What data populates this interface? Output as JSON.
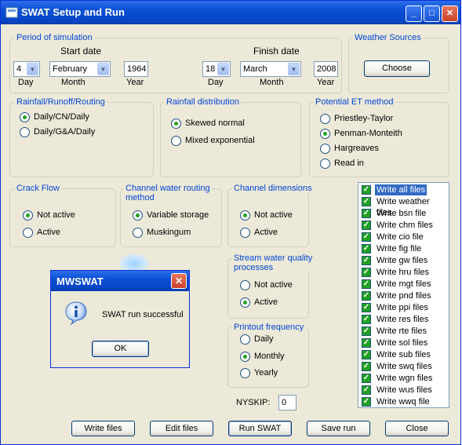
{
  "window": {
    "title": "SWAT Setup and Run",
    "min": "_",
    "max": "□",
    "close": "✕"
  },
  "period": {
    "title": "Period of simulation",
    "start_label": "Start date",
    "finish_label": "Finish date",
    "start": {
      "day": "4",
      "month": "February",
      "year": "1964"
    },
    "finish": {
      "day": "18",
      "month": "March",
      "year": "2008"
    },
    "day_label": "Day",
    "month_label": "Month",
    "year_label": "Year"
  },
  "weather": {
    "title": "Weather Sources",
    "button": "Choose"
  },
  "routing": {
    "title": "Rainfall/Runoff/Routing",
    "options": [
      "Daily/CN/Daily",
      "Daily/G&A/Daily"
    ],
    "selected": 0
  },
  "distribution": {
    "title": "Rainfall distribution",
    "options": [
      "Skewed normal",
      "Mixed exponential"
    ],
    "selected": 0
  },
  "et": {
    "title": "Potential ET method",
    "options": [
      "Priestley-Taylor",
      "Penman-Monteith",
      "Hargreaves",
      "Read in"
    ],
    "selected": 1
  },
  "crack": {
    "title": "Crack Flow",
    "options": [
      "Not active",
      "Active"
    ],
    "selected": 0
  },
  "channel_routing": {
    "title_line1": "Channel water routing",
    "title_line2": "method",
    "options": [
      "Variable storage",
      "Muskingum"
    ],
    "selected": 0
  },
  "channel_dim": {
    "title": "Channel dimensions",
    "options": [
      "Not active",
      "Active"
    ],
    "selected": 0
  },
  "stream_quality": {
    "title_line1": "Stream water quality",
    "title_line2": "processes",
    "options": [
      "Not active",
      "Active"
    ],
    "selected": 1
  },
  "printout": {
    "title": "Printout frequency",
    "options": [
      "Daily",
      "Monthly",
      "Yearly"
    ],
    "selected": 1
  },
  "nyskip": {
    "label": "NYSKIP:",
    "value": "0"
  },
  "files": {
    "items": [
      "Write all files",
      "Write weather files",
      "Write bsn file",
      "Write chm files",
      "Write cio file",
      "Write fig file",
      "Write gw files",
      "Write hru files",
      "Write mgt files",
      "Write pnd files",
      "Write ppi files",
      "Write res files",
      "Write rte files",
      "Write sol files",
      "Write sub files",
      "Write swq files",
      "Write wgn files",
      "Write wus files",
      "Write wwq file"
    ],
    "selected_index": 0
  },
  "buttons": {
    "write_files": "Write files",
    "edit_files": "Edit files",
    "run_swat": "Run SWAT",
    "save_run": "Save run",
    "close": "Close"
  },
  "dialog": {
    "title": "MWSWAT",
    "message": "SWAT run successful",
    "ok": "OK",
    "icon": "info-icon"
  }
}
